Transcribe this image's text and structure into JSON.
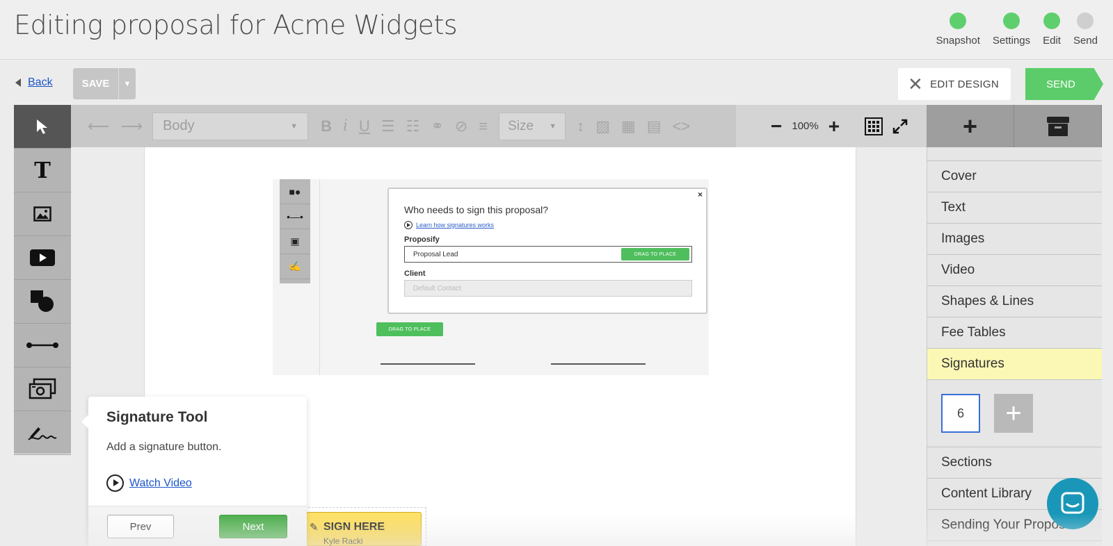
{
  "header": {
    "title": "Editing proposal for Acme Widgets",
    "steps": [
      {
        "label": "Snapshot",
        "status": "complete"
      },
      {
        "label": "Settings",
        "status": "complete"
      },
      {
        "label": "Edit",
        "status": "complete"
      },
      {
        "label": "Send",
        "status": "inactive"
      }
    ]
  },
  "actions": {
    "back_label": "Back",
    "save_label": "SAVE",
    "edit_design_label": "EDIT DESIGN",
    "send_label": "SEND"
  },
  "toolbar": {
    "style_value": "Body",
    "size_placeholder": "Size",
    "zoom": "100%"
  },
  "tools": [
    "select",
    "text",
    "image",
    "video",
    "shapes",
    "line",
    "fee-table",
    "signature"
  ],
  "right_panel": {
    "items_top": [
      "Cover",
      "Text",
      "Images",
      "Video",
      "Shapes & Lines",
      "Fee Tables",
      "Signatures"
    ],
    "thumbnail_label": "6",
    "items_bottom": [
      "Sections",
      "Content Library",
      "Sending Your Proposal"
    ]
  },
  "embedded_dialog": {
    "question": "Who needs to sign this proposal?",
    "learn_link": "Learn how signatures works",
    "group1": "Proposify",
    "field1": "Proposal Lead",
    "drag_label": "DRAG TO PLACE",
    "group2": "Client",
    "field2": "Default Contact",
    "close": "×"
  },
  "popover": {
    "title": "Signature Tool",
    "description": "Add a signature button.",
    "watch_label": "Watch Video",
    "prev_label": "Prev",
    "next_label": "Next"
  },
  "sign_button": {
    "label": "SIGN HERE",
    "name": "Kyle Racki"
  },
  "colors": {
    "accent_green": "#5ccc6a",
    "step_inactive": "#cfcfcf",
    "selected_item": "#fbf8b5",
    "chat": "#1a97b8"
  }
}
